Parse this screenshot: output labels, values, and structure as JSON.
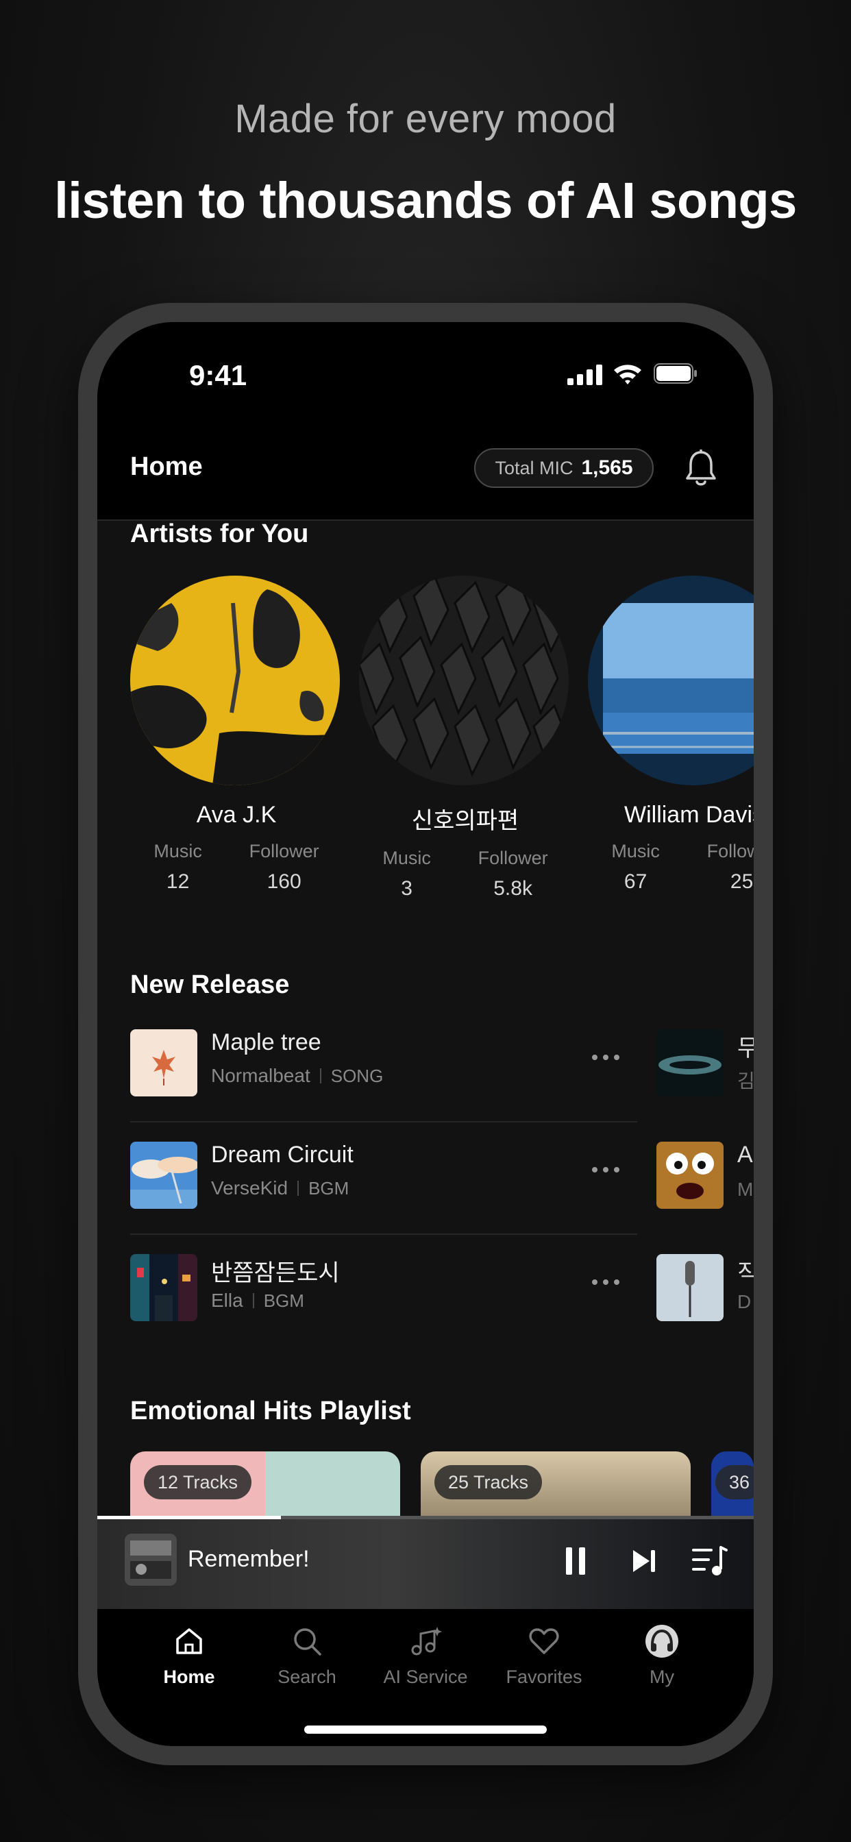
{
  "promo": {
    "subtitle": "Made for every mood",
    "title": "listen to thousands of AI songs"
  },
  "status_bar": {
    "time": "9:41"
  },
  "header": {
    "title": "Home",
    "mic_label": "Total MIC",
    "mic_value": "1,565"
  },
  "artists_section": {
    "title": "Artists for You",
    "music_label": "Music",
    "follower_label": "Follower",
    "items": [
      {
        "name": "Ava J.K",
        "music": "12",
        "follower": "160"
      },
      {
        "name": "신호의파편",
        "music": "3",
        "follower": "5.8k"
      },
      {
        "name": "William Davis",
        "music": "67",
        "follower": "25"
      }
    ]
  },
  "new_release": {
    "title": "New Release",
    "items": [
      {
        "title": "Maple tree",
        "artist": "Normalbeat",
        "type": "SONG"
      },
      {
        "title": "Dream Circuit",
        "artist": "VerseKid",
        "type": "BGM"
      },
      {
        "title": "반쯤잠든도시",
        "artist": "Ella",
        "type": "BGM"
      }
    ],
    "side_items": [
      {
        "title": "무",
        "artist": "김"
      },
      {
        "title": "A",
        "artist": "M"
      },
      {
        "title": "직",
        "artist": "D"
      }
    ]
  },
  "playlists": {
    "title": "Emotional Hits Playlist",
    "items": [
      {
        "tracks": "12 Tracks"
      },
      {
        "tracks": "25 Tracks"
      },
      {
        "tracks": "36"
      }
    ]
  },
  "player": {
    "title": "Remember!",
    "progress": 0.28
  },
  "tabs": [
    {
      "label": "Home",
      "icon": "home-icon",
      "active": true
    },
    {
      "label": "Search",
      "icon": "search-icon",
      "active": false
    },
    {
      "label": "AI Service",
      "icon": "music-sparkle-icon",
      "active": false
    },
    {
      "label": "Favorites",
      "icon": "heart-icon",
      "active": false
    },
    {
      "label": "My",
      "icon": "headphones-avatar-icon",
      "active": false
    }
  ],
  "colors": {
    "background": "#141414",
    "accent": "#ffffff",
    "muted_text": "#8a8a8a"
  }
}
